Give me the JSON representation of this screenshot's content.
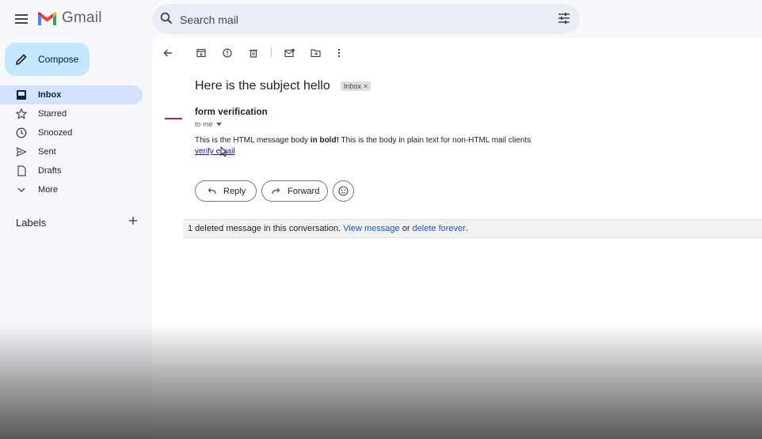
{
  "app": {
    "name": "Gmail"
  },
  "search": {
    "placeholder": "Search mail"
  },
  "compose": {
    "label": "Compose"
  },
  "sidebar": {
    "items": [
      {
        "label": "Inbox",
        "icon": "inbox-icon",
        "active": true
      },
      {
        "label": "Starred",
        "icon": "star-icon"
      },
      {
        "label": "Snoozed",
        "icon": "clock-icon"
      },
      {
        "label": "Sent",
        "icon": "send-icon"
      },
      {
        "label": "Drafts",
        "icon": "draft-icon"
      },
      {
        "label": "More",
        "icon": "chevron-down-icon"
      }
    ],
    "labels_heading": "Labels"
  },
  "message": {
    "subject": "Here is the subject hello",
    "label_chip": "Inbox",
    "chip_close": "×",
    "sender": "form verification",
    "recipient": "to me",
    "body_before_bold": "This is the HTML message body ",
    "body_bold": "in bold!",
    "body_after_bold": " This is the body in plain text for non-HTML mail clients",
    "link_text": "verify email"
  },
  "actions": {
    "reply": "Reply",
    "forward": "Forward"
  },
  "deleted_notice": {
    "text": "1 deleted message in this conversation.",
    "view_link": "View message",
    "or": "or",
    "delete_link": "delete forever",
    "period": "."
  },
  "colors": {
    "accent": "#c2e7ff",
    "active_nav": "#d3e3fd",
    "link": "#1a56b8"
  }
}
